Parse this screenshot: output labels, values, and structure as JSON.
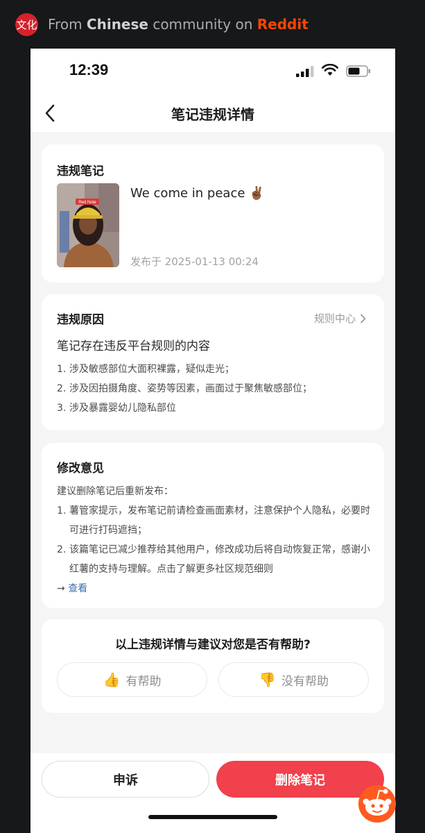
{
  "wrapper": {
    "logo_text": "文化",
    "prefix": "From ",
    "community": "Chinese",
    "middle": " community on ",
    "platform": "Reddit",
    "platform_color": "#ff4500"
  },
  "status_bar": {
    "time": "12:39"
  },
  "nav": {
    "title": "笔记违规详情",
    "back_icon": "chevron-left-icon"
  },
  "note": {
    "section_title": "违规笔记",
    "thumb_label": "Red Note",
    "title": "We come in peace ✌🏾",
    "date": "发布于 2025-01-13 00:24"
  },
  "reason": {
    "section_title": "违规原因",
    "rules_link": "规则中心",
    "headline": "笔记存在违反平台规则的内容",
    "items": [
      {
        "num": "1.",
        "text": "涉及敏感部位大面积裸露，疑似走光；"
      },
      {
        "num": "2.",
        "text": "涉及因拍摄角度、姿势等因素，画面过于聚焦敏感部位；"
      },
      {
        "num": "3.",
        "text": "涉及暴露婴幼儿隐私部位"
      }
    ]
  },
  "advice": {
    "section_title": "修改意见",
    "intro": "建议删除笔记后重新发布：",
    "items": [
      {
        "num": "1.",
        "text": "薯管家提示，发布笔记前请检查画面素材，注意保护个人隐私，必要时可进行打码遮挡；"
      },
      {
        "num": "2.",
        "text": "该篇笔记已减少推荐给其他用户，修改成功后将自动恢复正常，感谢小红薯的支持与理解。点击了解更多社区规范细则"
      }
    ],
    "arrow": "→ ",
    "view_link": "查看"
  },
  "feedback": {
    "question": "以上违规详情与建议对您是否有帮助?",
    "helpful": "有帮助",
    "not_helpful": "没有帮助",
    "helpful_icon": "thumbs-up-icon",
    "not_helpful_icon": "thumbs-down-icon"
  },
  "actions": {
    "appeal": "申诉",
    "delete": "删除笔记",
    "delete_color": "#f0414c"
  }
}
